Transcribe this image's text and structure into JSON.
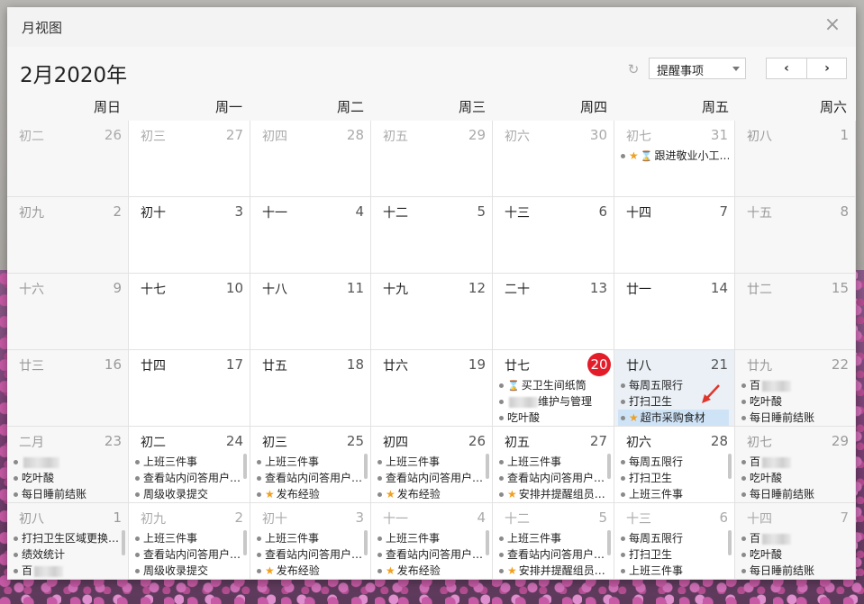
{
  "window": {
    "title": "月视图",
    "close_label": "×"
  },
  "header": {
    "month": "2月2020年",
    "refresh_icon": "↻",
    "filter_value": "提醒事项",
    "prev_label": "‹",
    "next_label": "›"
  },
  "weekdays": [
    "周日",
    "周一",
    "周二",
    "周三",
    "周四",
    "周五",
    "周六"
  ],
  "weeks": [
    [
      {
        "lunar": "初二",
        "day": "26",
        "other": true
      },
      {
        "lunar": "初三",
        "day": "27",
        "other": true
      },
      {
        "lunar": "初四",
        "day": "28",
        "other": true
      },
      {
        "lunar": "初五",
        "day": "29",
        "other": true
      },
      {
        "lunar": "初六",
        "day": "30",
        "other": true
      },
      {
        "lunar": "初七",
        "day": "31",
        "other": true,
        "events": [
          {
            "text": "跟进敬业小工…",
            "star": true,
            "hour": true
          }
        ]
      },
      {
        "lunar": "初八",
        "day": "1"
      }
    ],
    [
      {
        "lunar": "初九",
        "day": "2"
      },
      {
        "lunar": "初十",
        "day": "3"
      },
      {
        "lunar": "十一",
        "day": "4"
      },
      {
        "lunar": "十二",
        "day": "5"
      },
      {
        "lunar": "十三",
        "day": "6"
      },
      {
        "lunar": "十四",
        "day": "7"
      },
      {
        "lunar": "十五",
        "day": "8"
      }
    ],
    [
      {
        "lunar": "十六",
        "day": "9"
      },
      {
        "lunar": "十七",
        "day": "10"
      },
      {
        "lunar": "十八",
        "day": "11"
      },
      {
        "lunar": "十九",
        "day": "12"
      },
      {
        "lunar": "二十",
        "day": "13"
      },
      {
        "lunar": "廿一",
        "day": "14"
      },
      {
        "lunar": "廿二",
        "day": "15"
      }
    ],
    [
      {
        "lunar": "廿三",
        "day": "16"
      },
      {
        "lunar": "廿四",
        "day": "17"
      },
      {
        "lunar": "廿五",
        "day": "18"
      },
      {
        "lunar": "廿六",
        "day": "19"
      },
      {
        "lunar": "廿七",
        "day": "20",
        "today": true,
        "events": [
          {
            "text": "买卫生间纸筒",
            "hour": true
          },
          {
            "text": "维护与管理",
            "blur": true
          },
          {
            "text": "吃叶酸"
          }
        ]
      },
      {
        "lunar": "廿八",
        "day": "21",
        "highlight": true,
        "events": [
          {
            "text": "每周五限行"
          },
          {
            "text": "打扫卫生"
          },
          {
            "text": "超市采购食材",
            "star": true,
            "selected": true
          }
        ]
      },
      {
        "lunar": "廿九",
        "day": "22",
        "events": [
          {
            "text": "百",
            "blur": true
          },
          {
            "text": "吃叶酸"
          },
          {
            "text": "每日睡前结账"
          }
        ]
      }
    ],
    [
      {
        "lunar": "二月",
        "day": "23",
        "events": [
          {
            "text": "",
            "blur": true
          },
          {
            "text": "吃叶酸"
          },
          {
            "text": "每日睡前结账"
          }
        ]
      },
      {
        "lunar": "初二",
        "day": "24",
        "events": [
          {
            "text": "上班三件事"
          },
          {
            "text": "查看站内问答用户…"
          },
          {
            "text": "周级收录提交"
          }
        ],
        "scroll": true
      },
      {
        "lunar": "初三",
        "day": "25",
        "events": [
          {
            "text": "上班三件事"
          },
          {
            "text": "查看站内问答用户…"
          },
          {
            "text": "发布经验",
            "star": true
          }
        ],
        "scroll": true
      },
      {
        "lunar": "初四",
        "day": "26",
        "events": [
          {
            "text": "上班三件事"
          },
          {
            "text": "查看站内问答用户…"
          },
          {
            "text": "发布经验",
            "star": true
          }
        ],
        "scroll": true
      },
      {
        "lunar": "初五",
        "day": "27",
        "events": [
          {
            "text": "上班三件事"
          },
          {
            "text": "查看站内问答用户…"
          },
          {
            "text": "安排并提醒组员…",
            "star": true
          }
        ],
        "scroll": true
      },
      {
        "lunar": "初六",
        "day": "28",
        "events": [
          {
            "text": "每周五限行"
          },
          {
            "text": "打扫卫生"
          },
          {
            "text": "上班三件事"
          }
        ],
        "scroll": true
      },
      {
        "lunar": "初七",
        "day": "29",
        "events": [
          {
            "text": "百",
            "blur": true
          },
          {
            "text": "吃叶酸"
          },
          {
            "text": "每日睡前结账"
          }
        ]
      }
    ],
    [
      {
        "lunar": "初八",
        "day": "1",
        "events": [
          {
            "text": "打扫卫生区域更换…"
          },
          {
            "text": "绩效统计"
          },
          {
            "text": "百",
            "blur": true
          }
        ],
        "scroll": true
      },
      {
        "lunar": "初九",
        "day": "2",
        "other": true,
        "events": [
          {
            "text": "上班三件事"
          },
          {
            "text": "查看站内问答用户…"
          },
          {
            "text": "周级收录提交"
          }
        ],
        "scroll": true
      },
      {
        "lunar": "初十",
        "day": "3",
        "other": true,
        "events": [
          {
            "text": "上班三件事"
          },
          {
            "text": "查看站内问答用户…"
          },
          {
            "text": "发布经验",
            "star": true
          }
        ],
        "scroll": true
      },
      {
        "lunar": "十一",
        "day": "4",
        "other": true,
        "events": [
          {
            "text": "上班三件事"
          },
          {
            "text": "查看站内问答用户…"
          },
          {
            "text": "发布经验",
            "star": true
          }
        ],
        "scroll": true
      },
      {
        "lunar": "十二",
        "day": "5",
        "other": true,
        "events": [
          {
            "text": "上班三件事"
          },
          {
            "text": "查看站内问答用户…"
          },
          {
            "text": "安排并提醒组员…",
            "star": true
          }
        ],
        "scroll": true
      },
      {
        "lunar": "十三",
        "day": "6",
        "other": true,
        "events": [
          {
            "text": "每周五限行"
          },
          {
            "text": "打扫卫生"
          },
          {
            "text": "上班三件事"
          }
        ],
        "scroll": true
      },
      {
        "lunar": "十四",
        "day": "7",
        "other": true,
        "events": [
          {
            "text": "百",
            "blur": true
          },
          {
            "text": "吃叶酸"
          },
          {
            "text": "每日睡前结账"
          }
        ]
      }
    ]
  ]
}
